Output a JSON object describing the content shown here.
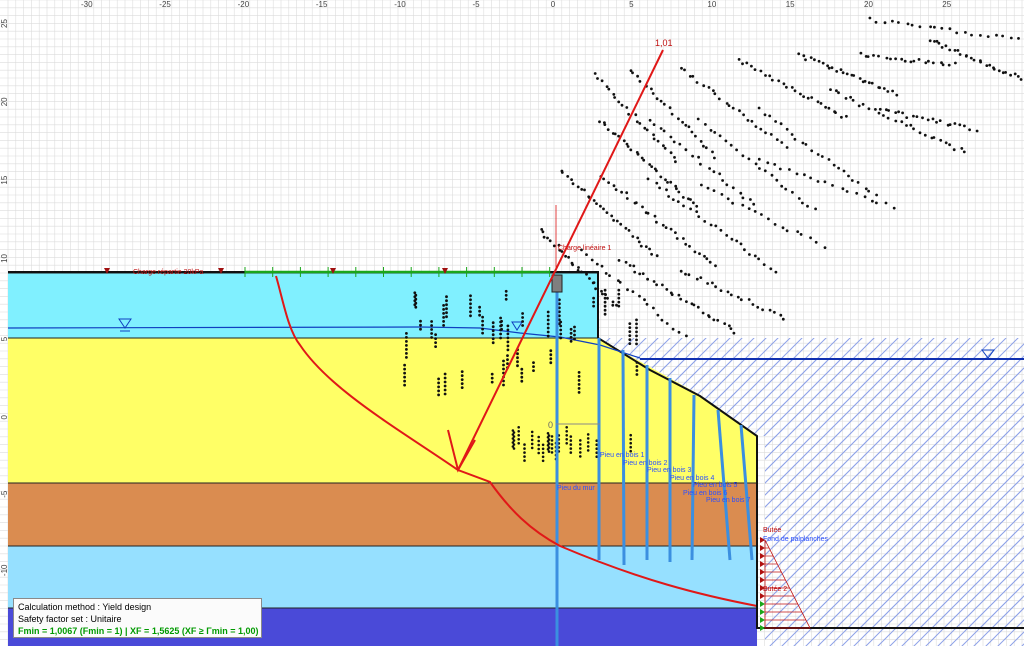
{
  "colors": {
    "grid": "#d2d2d2",
    "layer_top": "#80f0ff",
    "layer_yellow": "#ffff66",
    "layer_orange": "#da8c50",
    "layer_light_blue": "#96e0ff",
    "layer_bottom": "#4a4ad8",
    "water_line": "#1040c0",
    "slip_line": "#e01818",
    "pile": "#3b8fe0",
    "load_green": "#1aa61a",
    "result_green": "#009a00"
  },
  "axes": {
    "x_ticks": [
      "-30",
      "-25",
      "-20",
      "-15",
      "-10",
      "-5",
      "0",
      "5",
      "10",
      "15",
      "20",
      "25"
    ],
    "y_ticks": [
      "25",
      "20",
      "15",
      "10",
      "5",
      "0",
      "-5",
      "-10"
    ]
  },
  "labels": {
    "load": "Charge répartie 20kPa",
    "point_load": "Charge linéaire 1",
    "factor": "1,01",
    "zero_label": "0",
    "pile_wall": "Pieu du mur",
    "pile_1": "Pieu en bois 1",
    "pile_2": "Pieu en bois 2",
    "pile_3": "Pieu en bois 3",
    "pile_4": "Pieu en bois 4",
    "pile_5": "Pieu en bois 5",
    "pile_6": "Pieu en bois 6",
    "pile_7": "Pieu en bois 7",
    "anchor": "Butée",
    "sheet": "Fond de palplanches",
    "anchor2": "Butée 2"
  },
  "info": {
    "method": "Calculation method : Yield design",
    "safety": "Safety factor set : Unitaire",
    "result": "Fmin = 1,0067 (Fmin = 1)  |  XF = 1,5625 (XF ≥ Γmin = 1,00)"
  }
}
